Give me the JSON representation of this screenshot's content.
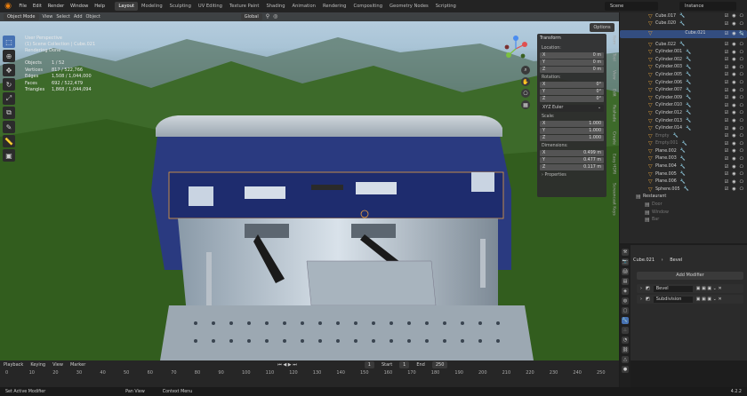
{
  "menu": {
    "file": "File",
    "edit": "Edit",
    "render": "Render",
    "window": "Window",
    "help": "Help"
  },
  "workspaces": [
    "Layout",
    "Modeling",
    "Sculpting",
    "UV Editing",
    "Texture Paint",
    "Shading",
    "Animation",
    "Rendering",
    "Compositing",
    "Geometry Nodes",
    "Scripting"
  ],
  "scene": "Scene",
  "view_layer": "Instance",
  "viewport": {
    "mode": "Object Mode",
    "view": "View",
    "select": "Select",
    "add": "Add",
    "object": "Object",
    "transform_orientation": "Global",
    "options": "Options",
    "info": {
      "line1": "User Perspective",
      "line2": "(1) Scene Collection | Cube.021",
      "line3": "Rendering Done"
    },
    "stats": [
      [
        "Objects",
        "1 / 52"
      ],
      [
        "Vertices",
        "817 / 522,766"
      ],
      [
        "Edges",
        "1,508 / 1,044,000"
      ],
      [
        "Faces",
        "692 / 522,479"
      ],
      [
        "Triangles",
        "1,868 / 1,044,094"
      ]
    ]
  },
  "npanel": {
    "title": "Transform",
    "location": "Location:",
    "rotation": "Rotation:",
    "mode": "XYZ Euler",
    "scale": "Scale:",
    "dimensions": "Dimensions:",
    "properties": "Properties",
    "loc": [
      [
        "X",
        "0 m"
      ],
      [
        "Y",
        "0 m"
      ],
      [
        "Z",
        "0 m"
      ]
    ],
    "rot": [
      [
        "X",
        "0°"
      ],
      [
        "Y",
        "0°"
      ],
      [
        "Z",
        "0°"
      ]
    ],
    "scl": [
      [
        "X",
        "1.000"
      ],
      [
        "Y",
        "1.000"
      ],
      [
        "Z",
        "1.000"
      ]
    ],
    "dim": [
      [
        "X",
        "0.499 m"
      ],
      [
        "Y",
        "0.477 m"
      ],
      [
        "Z",
        "0.117 m"
      ]
    ],
    "tabs": [
      "Item",
      "Tool",
      "View",
      "Edit",
      "Reshade",
      "Create",
      "Easy HDRI",
      "Screencast Keys"
    ]
  },
  "outliner": {
    "rows": [
      {
        "name": "Cube.017",
        "sel": false,
        "dim": false
      },
      {
        "name": "Cube.020",
        "sel": false,
        "dim": false
      },
      {
        "name": "Cube.021",
        "sel": true,
        "dim": false
      },
      {
        "name": "Cube.022",
        "sel": false,
        "dim": false
      },
      {
        "name": "Cylinder.001",
        "sel": false,
        "dim": false
      },
      {
        "name": "Cylinder.002",
        "sel": false,
        "dim": false
      },
      {
        "name": "Cylinder.003",
        "sel": false,
        "dim": false
      },
      {
        "name": "Cylinder.005",
        "sel": false,
        "dim": false
      },
      {
        "name": "Cylinder.006",
        "sel": false,
        "dim": false
      },
      {
        "name": "Cylinder.007",
        "sel": false,
        "dim": false
      },
      {
        "name": "Cylinder.009",
        "sel": false,
        "dim": false
      },
      {
        "name": "Cylinder.010",
        "sel": false,
        "dim": false
      },
      {
        "name": "Cylinder.012",
        "sel": false,
        "dim": false
      },
      {
        "name": "Cylinder.013",
        "sel": false,
        "dim": false
      },
      {
        "name": "Cylinder.014",
        "sel": false,
        "dim": false
      },
      {
        "name": "Empty",
        "sel": false,
        "dim": true
      },
      {
        "name": "Empty.001",
        "sel": false,
        "dim": true
      },
      {
        "name": "Plane.002",
        "sel": false,
        "dim": false
      },
      {
        "name": "Plane.003",
        "sel": false,
        "dim": false
      },
      {
        "name": "Plane.004",
        "sel": false,
        "dim": false
      },
      {
        "name": "Plane.005",
        "sel": false,
        "dim": false
      },
      {
        "name": "Plane.006",
        "sel": false,
        "dim": false
      },
      {
        "name": "Sphere.005",
        "sel": false,
        "dim": false
      }
    ],
    "collections": [
      "Restaurant",
      "Door",
      "Window",
      "Bar"
    ]
  },
  "properties": {
    "object": "Cube.021",
    "modifier_tab": "Bevel",
    "add_modifier": "Add Modifier",
    "modifiers": [
      "Bevel",
      "Subdivision"
    ]
  },
  "timeline": {
    "playback": "Playback",
    "keying": "Keying",
    "view": "View",
    "marker": "Marker",
    "current": "1",
    "start_label": "Start",
    "start": "1",
    "end_label": "End",
    "end": "250",
    "ticks": [
      "0",
      "10",
      "20",
      "30",
      "40",
      "50",
      "60",
      "70",
      "80",
      "90",
      "100",
      "110",
      "120",
      "130",
      "140",
      "150",
      "160",
      "170",
      "180",
      "190",
      "200",
      "210",
      "220",
      "230",
      "240",
      "250"
    ]
  },
  "status": {
    "left": "Set Active Modifier",
    "middle": "Pan View",
    "right": "Context Menu",
    "version": "4.2.2"
  }
}
